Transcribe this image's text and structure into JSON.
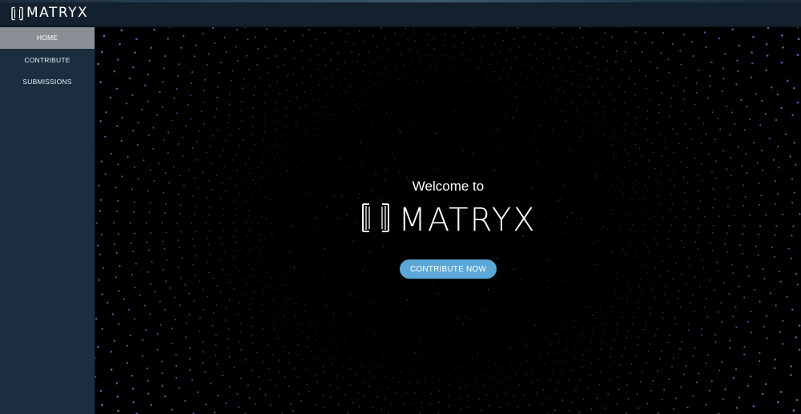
{
  "header": {
    "logo_text": "MATRYX"
  },
  "sidebar": {
    "items": [
      {
        "label": "HOME",
        "active": true
      },
      {
        "label": "CONTRIBUTE",
        "active": false
      },
      {
        "label": "SUBMISSIONS",
        "active": false
      }
    ]
  },
  "hero": {
    "welcome_text": "Welcome to",
    "logo_text": "MATRYX",
    "cta_label": "CONTRIBUTE NOW"
  },
  "colors": {
    "header_bg": "#13202e",
    "sidebar_bg": "#1a2e40",
    "active_nav_bg": "#8a8f95",
    "cta_bg": "#5aa8d8",
    "dot_color": "#6f8df0"
  },
  "icons": {
    "logo": "matryx-cube-icon"
  }
}
